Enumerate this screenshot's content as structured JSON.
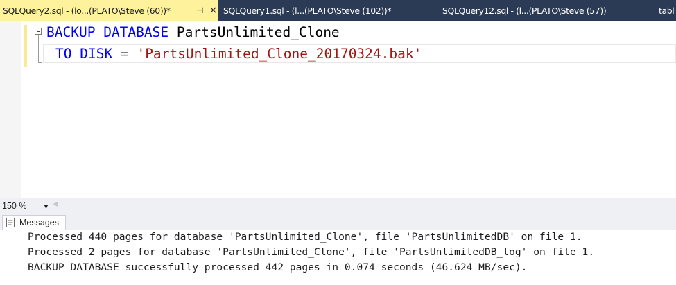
{
  "tabs": [
    {
      "label": "SQLQuery2.sql - (lo...(PLATO\\Steve (60))*",
      "active": true
    },
    {
      "label": "SQLQuery1.sql - (l...(PLATO\\Steve (102))*",
      "active": false
    },
    {
      "label": "SQLQuery12.sql - (l...(PLATO\\Steve (57))",
      "active": false
    },
    {
      "label": "tabl",
      "active": false
    }
  ],
  "editor": {
    "line1": {
      "kw1": "BACKUP",
      "kw2": "DATABASE",
      "name": "PartsUnlimited_Clone"
    },
    "line2": {
      "kw1": "TO",
      "kw2": "DISK",
      "op": "=",
      "str": "'PartsUnlimited_Clone_20170324.bak'"
    }
  },
  "zoom": {
    "value": "150 %"
  },
  "results": {
    "tab_label": "Messages",
    "lines": [
      "Processed 440 pages for database 'PartsUnlimited_Clone', file 'PartsUnlimitedDB' on file 1.",
      "Processed 2 pages for database 'PartsUnlimited_Clone', file 'PartsUnlimitedDB_log' on file 1.",
      "BACKUP DATABASE successfully processed 442 pages in 0.074 seconds (46.624 MB/sec)."
    ]
  },
  "colors": {
    "tab_strip": "#2b3a55",
    "active_tab": "#fff29d",
    "keyword": "#0000ff",
    "string": "#a31515",
    "operator": "#808080"
  },
  "icons": {
    "pin": "pin-icon",
    "close": "close-icon",
    "messages": "messages-icon",
    "dropdown": "chevron-down-icon"
  }
}
